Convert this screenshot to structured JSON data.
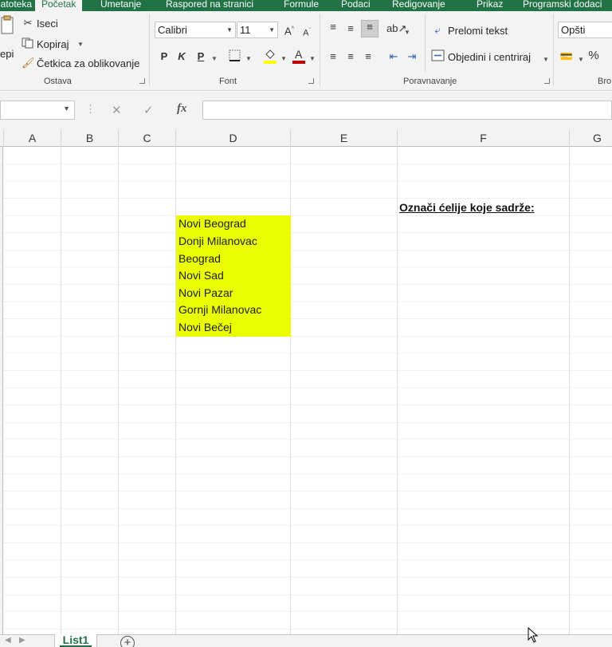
{
  "tabs": [
    "Datoteka",
    "Početak",
    "Umetanje",
    "Raspored na stranici",
    "Formule",
    "Podaci",
    "Redigovanje",
    "Prikaz",
    "Programski dodaci"
  ],
  "clipboard": {
    "paste_label": "epi",
    "cut_label": "Iseci",
    "copy_label": "Kopiraj",
    "format_painter_label": "Četkica za oblikovanje",
    "group_label": "Ostava"
  },
  "font": {
    "family": "Calibri",
    "size": "11",
    "bold": "P",
    "italic": "K",
    "underline": "P",
    "group_label": "Font",
    "fill_color": "#ffff00",
    "font_color": "#c00000"
  },
  "alignment": {
    "wrap_text_label": "Prelomi tekst",
    "merge_label": "Objedini i centriraj",
    "group_label": "Poravnavanje"
  },
  "number": {
    "format": "Opšti",
    "percent": "%",
    "group_label": "Bro"
  },
  "formula_bar": {
    "fx": "fx",
    "cancel": "✕",
    "enter": "✓"
  },
  "columns": [
    "A",
    "B",
    "C",
    "D",
    "E",
    "F",
    "G"
  ],
  "cells": {
    "cities": [
      "Novi Beograd",
      "Donji Milanovac",
      "Beograd",
      "Novi Sad",
      "Novi Pazar",
      "Gornji Milanovac",
      "Novi Bečej"
    ],
    "highlight_color": "#eaff00",
    "f_label": "Označi ćelije koje sadrže:"
  },
  "sheets": {
    "active": "List1",
    "add": "+"
  },
  "colors": {
    "ribbon_accent": "#217346"
  }
}
